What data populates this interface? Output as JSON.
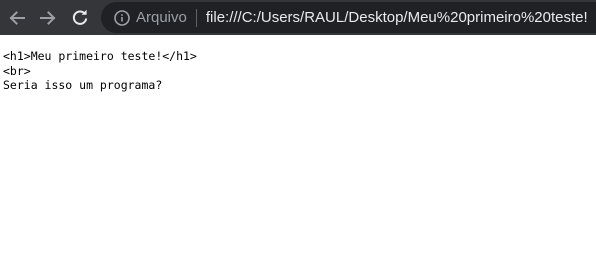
{
  "browser": {
    "toolbar": {
      "back_icon": "arrow-left-icon",
      "forward_icon": "arrow-right-icon",
      "reload_icon": "reload-icon"
    },
    "omnibox": {
      "security_icon": "info-circle-icon",
      "security_label": "Arquivo",
      "url": "file:///C:/Users/RAUL/Desktop/Meu%20primeiro%20teste!"
    },
    "colors": {
      "toolbar_bg": "#35363a",
      "omnibox_bg": "#202124",
      "icon": "#9aa0a6",
      "url_text": "#e8eaed"
    }
  },
  "page": {
    "lines": [
      "<h1>Meu primeiro teste!</h1>",
      "<br>",
      "Seria isso um programa?"
    ]
  }
}
